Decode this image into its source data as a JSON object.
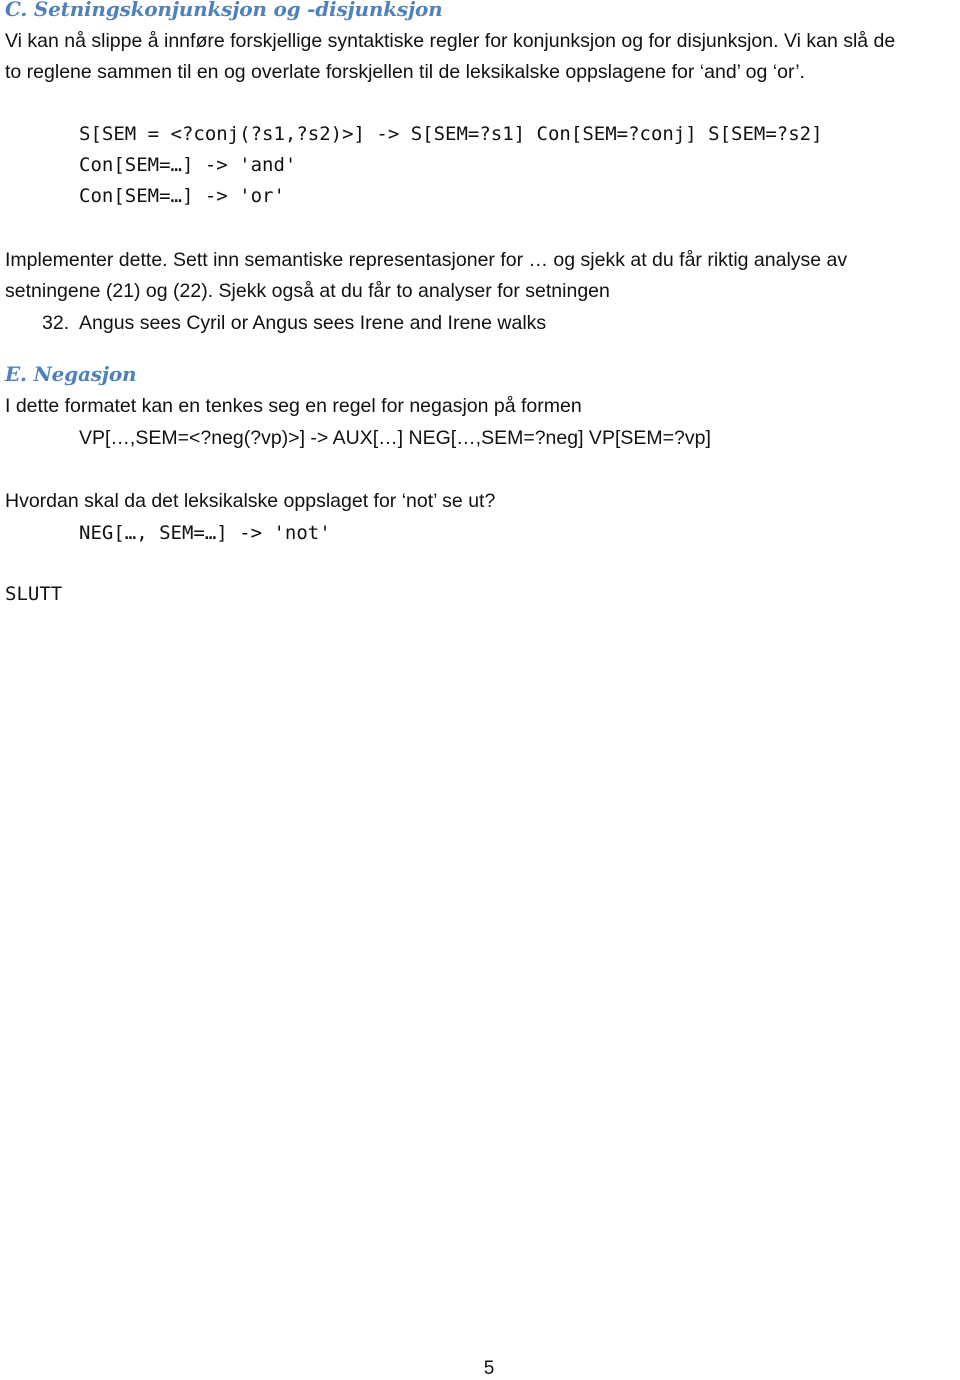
{
  "section_c": {
    "heading": "C. Setningskonjunksjon og -disjunksjon",
    "intro_line_1": "Vi kan nå slippe å innføre forskjellige syntaktiske regler for konjunksjon og for disjunksjon.  Vi kan slå de",
    "intro_line_2": "to reglene sammen til en og overlate forskjellen til de leksikalske oppslagene for ‘and’ og ‘or’.",
    "rules": [
      "S[SEM = <?conj(?s1,?s2)>] -> S[SEM=?s1] Con[SEM=?conj] S[SEM=?s2]",
      "Con[SEM=…] -> 'and'",
      "Con[SEM=…] -> 'or'"
    ],
    "task_line_1": "Implementer dette. Sett inn semantiske representasjoner for … og sjekk at du får riktig analyse av",
    "task_line_2": "setningene (21) og (22).  Sjekk også at du får to analyser for setningen",
    "example_number": "32.",
    "example_sentence": "Angus sees Cyril or Angus sees Irene and Irene walks"
  },
  "section_e": {
    "heading": "E. Negasjon",
    "intro": "I dette formatet kan en tenkes seg en regel for negasjon på formen",
    "rule": "VP[…,SEM=<?neg(?vp)>] -> AUX[…] NEG[…,SEM=?neg] VP[SEM=?vp]",
    "question": "Hvordan skal da det leksikalske oppslaget for ‘not’ se ut?",
    "lexical_entry": "NEG[…, SEM=…] -> 'not'"
  },
  "end_marker": "SLUTT",
  "page_number": "5"
}
